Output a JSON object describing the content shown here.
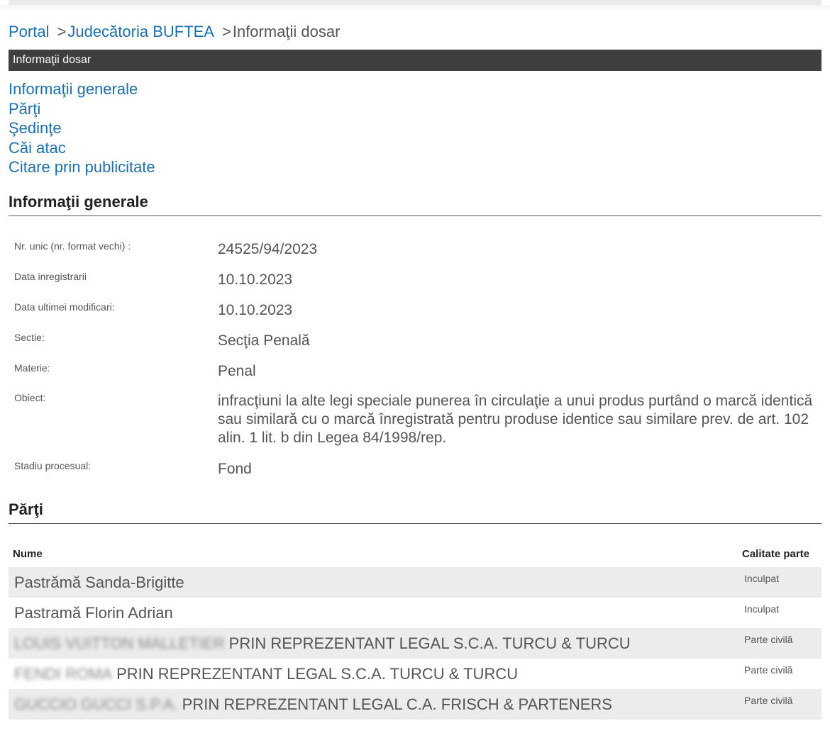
{
  "breadcrumb": {
    "portal": "Portal",
    "court": "Judecătoria BUFTEA",
    "current": "Informaţii dosar",
    "separator": ">"
  },
  "section_bar": {
    "title": "Informaţii dosar"
  },
  "anchors": [
    "Informaţii generale",
    "Părţi",
    "Şedinţe",
    "Căi atac",
    "Citare prin publicitate"
  ],
  "general": {
    "heading": "Informaţii generale",
    "rows": [
      {
        "label": "Nr. unic (nr. format vechi) :",
        "value": "24525/94/2023"
      },
      {
        "label": "Data inregistrarii",
        "value": "10.10.2023"
      },
      {
        "label": "Data ultimei modificari:",
        "value": "10.10.2023"
      },
      {
        "label": "Sectie:",
        "value": "Secţia Penală"
      },
      {
        "label": "Materie:",
        "value": "Penal"
      },
      {
        "label": "Obiect:",
        "value": "infracţiuni la alte legi speciale punerea în circulaţie a unui produs purtând o marcă identică sau similară cu o marcă înregistrată pentru produse identice sau similare prev. de art. 102 alin. 1 lit. b din Legea 84/1998/rep."
      },
      {
        "label": "Stadiu procesual:",
        "value": "Fond"
      }
    ]
  },
  "parti": {
    "heading": "Părţi",
    "columns": {
      "name": "Nume",
      "calitate": "Calitate parte"
    },
    "rows": [
      {
        "blurred": "",
        "name": "Pastrămă Sanda-Brigitte",
        "calitate": "Inculpat"
      },
      {
        "blurred": "",
        "name": "Pastramă Florin Adrian",
        "calitate": "Inculpat"
      },
      {
        "blurred": "LOUIS VUITTON MALLETIER",
        "name": "PRIN REPREZENTANT LEGAL S.C.A. TURCU & TURCU",
        "calitate": "Parte civilă"
      },
      {
        "blurred": "FENDI ROMA",
        "name": "PRIN REPREZENTANT LEGAL S.C.A. TURCU & TURCU",
        "calitate": "Parte civilă"
      },
      {
        "blurred": "GUCCIO GUCCI S.P.A.",
        "name": "PRIN REPREZENTANT LEGAL C.A. FRISCH & PARTENERS",
        "calitate": "Parte civilă"
      }
    ]
  }
}
